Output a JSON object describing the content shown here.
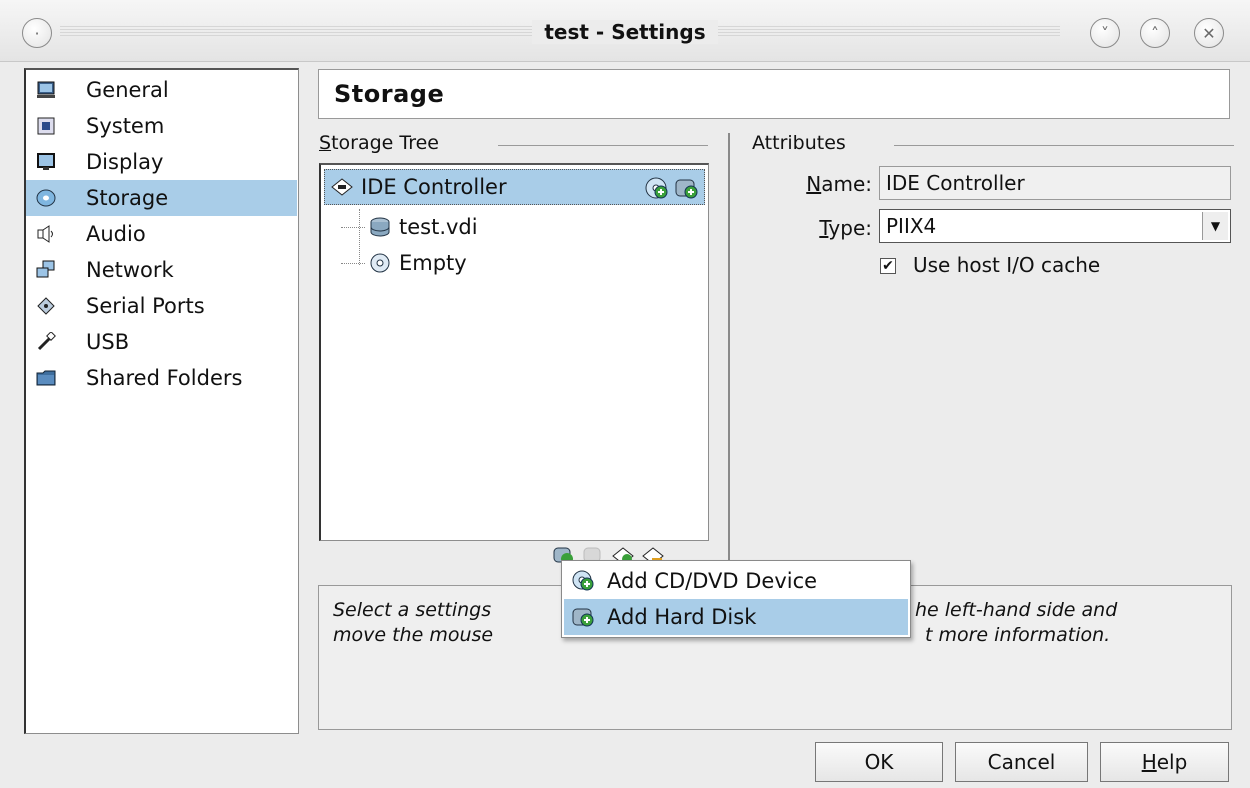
{
  "window": {
    "title": "test - Settings",
    "buttons": [
      "minimize",
      "maximize",
      "close"
    ]
  },
  "sidebar": {
    "items": [
      {
        "label": "General",
        "icon": "monitor-icon"
      },
      {
        "label": "System",
        "icon": "chip-icon"
      },
      {
        "label": "Display",
        "icon": "display-icon"
      },
      {
        "label": "Storage",
        "icon": "disc-icon",
        "selected": true
      },
      {
        "label": "Audio",
        "icon": "speaker-icon"
      },
      {
        "label": "Network",
        "icon": "network-icon"
      },
      {
        "label": "Serial Ports",
        "icon": "serial-port-icon"
      },
      {
        "label": "USB",
        "icon": "usb-icon"
      },
      {
        "label": "Shared Folders",
        "icon": "folder-icon"
      }
    ]
  },
  "page": {
    "title": "Storage"
  },
  "storage_tree": {
    "label": "Storage Tree",
    "label_mnemonic": "S",
    "label_rest": "torage Tree",
    "items": [
      {
        "label": "IDE Controller",
        "icon": "ide-controller-icon",
        "selected": true
      },
      {
        "label": "test.vdi",
        "icon": "hard-disk-icon"
      },
      {
        "label": "Empty",
        "icon": "cd-icon"
      }
    ]
  },
  "attributes": {
    "label": "Attributes",
    "name_label_mn": "N",
    "name_label_rest": "ame:",
    "name_value": "IDE Controller",
    "type_label_mn": "T",
    "type_label_rest": "ype:",
    "type_value": "PIIX4",
    "host_cache_label": "Use host I/O cache",
    "host_cache_checked": true
  },
  "context_menu": {
    "items": [
      {
        "label": "Add CD/DVD Device",
        "icon": "add-cd-icon"
      },
      {
        "label": "Add Hard Disk",
        "icon": "add-hard-disk-icon",
        "highlighted": true
      }
    ]
  },
  "info": {
    "line1_a": "Select a settings ",
    "line1_b": "he left-hand side and",
    "line2_a": "move the mouse ",
    "line2_b": "t more information."
  },
  "buttons": {
    "ok": "OK",
    "cancel": "Cancel",
    "help_mn": "H",
    "help_rest": "elp"
  }
}
